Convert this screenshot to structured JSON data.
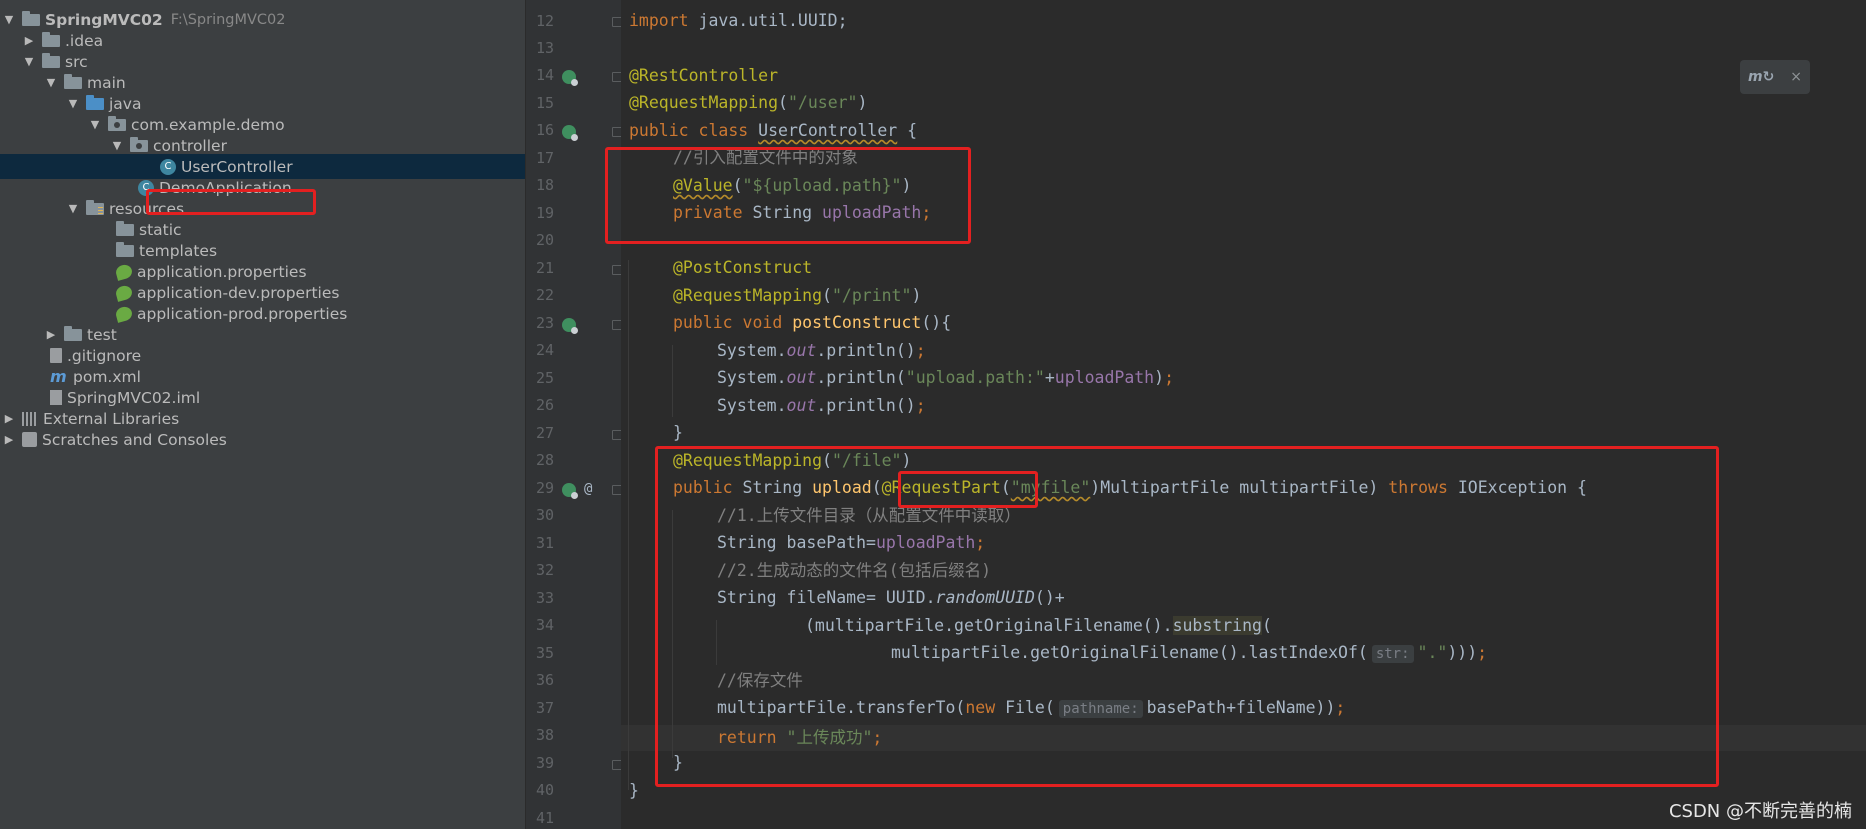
{
  "project_tree": [
    {
      "label": "SpringMVC02",
      "path": "F:\\SpringMVC02",
      "icon": "project-folder-icon",
      "expanded": true,
      "bold": true
    },
    {
      "label": ".idea",
      "icon": "folder-icon",
      "expanded": false
    },
    {
      "label": "src",
      "icon": "folder-icon",
      "expanded": true
    },
    {
      "label": "main",
      "icon": "folder-icon",
      "expanded": true
    },
    {
      "label": "java",
      "icon": "source-folder-icon",
      "expanded": true
    },
    {
      "label": "com.example.demo",
      "icon": "package-icon",
      "expanded": true
    },
    {
      "label": "controller",
      "icon": "package-icon",
      "expanded": true
    },
    {
      "label": "UserController",
      "icon": "class-icon",
      "selected": true
    },
    {
      "label": "DemoApplication",
      "icon": "spring-class-icon"
    },
    {
      "label": "resources",
      "icon": "resources-folder-icon",
      "expanded": true
    },
    {
      "label": "static",
      "icon": "folder-icon"
    },
    {
      "label": "templates",
      "icon": "folder-icon"
    },
    {
      "label": "application.properties",
      "icon": "spring-properties-icon"
    },
    {
      "label": "application-dev.properties",
      "icon": "spring-properties-icon"
    },
    {
      "label": "application-prod.properties",
      "icon": "spring-properties-icon"
    },
    {
      "label": "test",
      "icon": "folder-icon",
      "expanded": false
    },
    {
      "label": ".gitignore",
      "icon": "gitignore-icon"
    },
    {
      "label": "pom.xml",
      "icon": "maven-icon"
    },
    {
      "label": "SpringMVC02.iml",
      "icon": "iml-icon"
    },
    {
      "label": "External Libraries",
      "icon": "libraries-icon",
      "expanded": false
    },
    {
      "label": "Scratches and Consoles",
      "icon": "scratches-icon",
      "expanded": false
    }
  ],
  "line_numbers": [
    "12",
    "13",
    "14",
    "15",
    "16",
    "17",
    "18",
    "19",
    "20",
    "21",
    "22",
    "23",
    "24",
    "25",
    "26",
    "27",
    "28",
    "29",
    "30",
    "31",
    "32",
    "33",
    "34",
    "35",
    "36",
    "37",
    "38",
    "39",
    "40",
    "41"
  ],
  "code": {
    "l12_kw": "import",
    "l12_rest": " java.util.UUID;",
    "l14": "@RestController",
    "l15_an": "@RequestMapping",
    "l15_p1": "(",
    "l15_str": "\"/user\"",
    "l15_p2": ")",
    "l16_kw": "public class",
    "l16_sp": " ",
    "l16_name": "UserController",
    "l16_end": " {",
    "l17": "//引入配置文件中的对象",
    "l18_an": "@Value",
    "l18_p1": "(",
    "l18_str": "\"${upload.path}\"",
    "l18_p2": ")",
    "l19_kw": "private",
    "l19_type": " String ",
    "l19_field": "uploadPath",
    "l19_semi": ";",
    "l21": "@PostConstruct",
    "l22_an": "@RequestMapping",
    "l22_p1": "(",
    "l22_str": "\"/print\"",
    "l22_p2": ")",
    "l23_kw": "public void",
    "l23_sp": " ",
    "l23_fn": "postConstruct",
    "l23_end": "(){",
    "l24_a": "System.",
    "l24_out": "out",
    "l24_b": ".println()",
    "l24_semi": ";",
    "l25_a": "System.",
    "l25_out": "out",
    "l25_b": ".println(",
    "l25_str": "\"upload.path:\"",
    "l25_plus": "+",
    "l25_field": "uploadPath",
    "l25_end": ")",
    "l25_semi": ";",
    "l26_a": "System.",
    "l26_out": "out",
    "l26_b": ".println()",
    "l26_semi": ";",
    "l27": "}",
    "l28_an": "@RequestMapping",
    "l28_p1": "(",
    "l28_str": "\"/file\"",
    "l28_p2": ")",
    "l29_kw": "public",
    "l29_a": " String ",
    "l29_fn": "upload",
    "l29_p1": "(",
    "l29_an": "@RequestPart",
    "l29_p2": "(",
    "l29_str": "\"myfile\"",
    "l29_b": ")MultipartFile multipartFile) ",
    "l29_throws": "throws",
    "l29_c": " IOException {",
    "l30": "//1.上传文件目录（从配置文件中读取）",
    "l31_a": "String basePath=",
    "l31_field": "uploadPath",
    "l31_semi": ";",
    "l32": "//2.生成动态的文件名(包括后缀名)",
    "l33_a": "String fileName= UUID.",
    "l33_fn": "randomUUID",
    "l33_b": "()+",
    "l34_a": "(multipartFile.getOriginalFilename().",
    "l34_hl": "substring",
    "l34_b": "(",
    "l35_a": "multipartFile.getOriginalFilename().lastIndexOf(",
    "l35_hint": "str:",
    "l35_str": "\".\"",
    "l35_b": ")))",
    "l35_semi": ";",
    "l36": "//保存文件",
    "l37_a": "multipartFile.transferTo(",
    "l37_kw": "new",
    "l37_b": " File(",
    "l37_hint": "pathname:",
    "l37_c": "basePath+fileName))",
    "l37_semi": ";",
    "l38_kw": "return",
    "l38_sp": " ",
    "l38_str": "\"上传成功\"",
    "l38_semi": ";",
    "l39": "}",
    "l40": "}"
  },
  "maven_badge": {
    "icon": "maven-reload-icon",
    "close": "×"
  },
  "watermark": "CSDN @不断完善的楠",
  "colors": {
    "highlight_box": "#e32020",
    "keyword": "#cc7832",
    "annotation": "#bbb529",
    "string": "#6a8759",
    "comment": "#808080",
    "field": "#9876aa",
    "method": "#ffc66d"
  }
}
